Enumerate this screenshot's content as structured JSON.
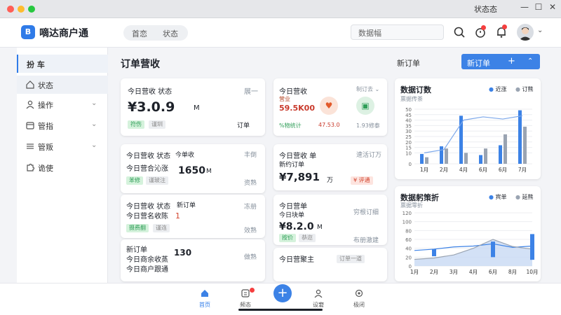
{
  "window": {
    "status": "状态态",
    "controls": [
      "—",
      "☐",
      "✕"
    ],
    "dots": [
      "#ff5f57",
      "#febc2e",
      "#28c840"
    ]
  },
  "header": {
    "logo_text": "B",
    "app_name": "嘀达商户通",
    "segments": [
      "首恋",
      "状态"
    ],
    "search_placeholder": "数据幅",
    "alert_badge": "1"
  },
  "sidebar": {
    "items": [
      {
        "label": "扮 车",
        "icon": "cart-icon"
      },
      {
        "label": "状态",
        "icon": "home-icon"
      },
      {
        "label": "操作",
        "icon": "user-icon",
        "chevron": "⌄"
      },
      {
        "label": "管指",
        "icon": "wallet-icon",
        "chevron": "⌄"
      },
      {
        "label": "管叛",
        "icon": "menu-icon",
        "chevron": "⌄"
      },
      {
        "label": "诡使",
        "icon": "puzzle-icon"
      }
    ]
  },
  "main": {
    "title": "订单营收",
    "new_order_label": "新订单",
    "new_button": {
      "label": "新订单",
      "plus": "+",
      "chevron": "⌃"
    }
  },
  "cards": {
    "c1": {
      "title": "今日营收 状态",
      "tag": "展一",
      "value": "¥3.0.9",
      "unit": "M",
      "chip1": "符伤",
      "chip2": "谨圳",
      "side": "订单"
    },
    "c2": {
      "title": "今日营收",
      "sub": "营业",
      "amount": "59.5K00",
      "tag": "制订去 ⌄",
      "label": "%物统计",
      "pct": "47.53.0",
      "right": "1.93修泰"
    },
    "c3": {
      "line1": "今日营收 状态",
      "line1b": "今单收",
      "tag": "丰倒",
      "line2": "今日营合沁涨",
      "value": "1650",
      "unit": "M",
      "chip1": "苯修",
      "chip2": "谨玻注",
      "side": "资熟"
    },
    "c4": {
      "title": "今日营收 单",
      "tag": "速活订万",
      "line2": "新约订单",
      "value": "¥7,891",
      "unit": "万",
      "chip": "¥ 评通"
    },
    "c5": {
      "line1": "今日营收 状态",
      "line1b": "新订单",
      "line2": "今日营名收陈",
      "side_num": "1",
      "tag": "冻册",
      "chip1": "摄费翻",
      "chip2": "谨连",
      "side": "效熟"
    },
    "c6": {
      "title": "今日营单",
      "line2": "今日块单",
      "tag": "穷根订细",
      "value": "¥8.2.0",
      "unit": "M",
      "chip1": "按价",
      "chip2": "恭迩",
      "side": "布册澈建"
    },
    "c7": {
      "title": "新订单",
      "line2": "今日商余收蒸",
      "line3": "今日商户跟通",
      "value": "130",
      "tag": "做熟"
    },
    "c8": {
      "title": "今日营聚主",
      "chip": "订单一道"
    }
  },
  "chart1": {
    "title": "数据订数",
    "subtitle": "票据传茶",
    "legend": [
      {
        "name": "近涨",
        "color": "#3c82e6"
      },
      {
        "name": "订熊",
        "color": "#9aa4b2"
      }
    ]
  },
  "chart2": {
    "title": "数据躬策折",
    "subtitle": "票据零折",
    "legend": [
      {
        "name": "宾单",
        "color": "#3c82e6"
      },
      {
        "name": "延熊",
        "color": "#9aa4b2"
      }
    ]
  },
  "chart_data": [
    {
      "type": "bar",
      "title": "数据订数",
      "categories": [
        "1月",
        "2月",
        "4月",
        "6月",
        "6月",
        "7月"
      ],
      "ylim": [
        0,
        50
      ],
      "yticks": [
        0,
        10,
        15,
        20,
        25,
        30,
        35,
        40,
        45,
        50
      ],
      "series": [
        {
          "name": "近涨",
          "values": [
            9,
            16,
            44,
            8,
            17,
            49
          ]
        },
        {
          "name": "订熊",
          "values": [
            6,
            14,
            10,
            14,
            27,
            34
          ]
        }
      ],
      "trend_line": [
        10,
        13,
        40,
        43,
        41,
        44
      ],
      "grid": true,
      "legend": "top-right"
    },
    {
      "type": "line",
      "title": "数据躬策折",
      "categories": [
        "1月",
        "2月",
        "3月",
        "4月",
        "6月",
        "8月",
        "10月"
      ],
      "ylim": [
        0,
        120
      ],
      "yticks": [
        0,
        20,
        40,
        60,
        80,
        100,
        120
      ],
      "series": [
        {
          "name": "宾单",
          "values": [
            35,
            38,
            43,
            45,
            50,
            42,
            45
          ]
        },
        {
          "name": "延熊",
          "values": [
            15,
            18,
            25,
            40,
            60,
            44,
            38
          ]
        }
      ],
      "ranges": [
        {
          "x_index": 1,
          "low": 22,
          "high": 38
        },
        {
          "x_index": 4,
          "low": 20,
          "high": 55
        },
        {
          "x_index": 6,
          "low": 14,
          "high": 72
        }
      ],
      "grid": true,
      "legend": "top-right"
    }
  ],
  "tabbar": {
    "items": [
      {
        "label": "首页",
        "icon": "home-icon"
      },
      {
        "label": "频态",
        "icon": "orders-icon"
      },
      {
        "label": "设窘",
        "icon": "user-icon"
      },
      {
        "label": "极闭",
        "icon": "settings-icon"
      }
    ],
    "fab": "+"
  }
}
